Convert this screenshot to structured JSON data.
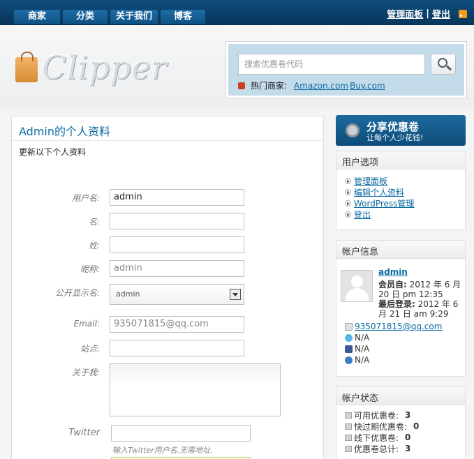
{
  "nav": {
    "tabs": [
      "商家",
      "分类",
      "关于我们",
      "博客"
    ]
  },
  "top_links": {
    "dashboard": "管理面板",
    "sep": "|",
    "logout": "登出"
  },
  "logo": {
    "text": "Clipper"
  },
  "search": {
    "placeholder": "搜索优惠卷代码",
    "hot_label": "热门商家:",
    "hot_stores": [
      "Amazon.com",
      "Buy.com"
    ]
  },
  "profile": {
    "title": "Admin的个人资料",
    "subtitle": "更新以下个人资料",
    "fields": {
      "username": {
        "label": "用户名:",
        "value": "admin"
      },
      "first_name": {
        "label": "名:",
        "value": ""
      },
      "last_name": {
        "label": "姓:",
        "value": ""
      },
      "nickname": {
        "label": "昵称:",
        "value": "admin"
      },
      "display_name": {
        "label": "公开显示名:",
        "value": "admin"
      },
      "email": {
        "label": "Email:",
        "value": "935071815@qq.com"
      },
      "website": {
        "label": "站点:",
        "value": ""
      },
      "about": {
        "label": "关于我:"
      },
      "twitter": {
        "label": "Twitter",
        "value": "",
        "hint": "输入Twitter用户名,无需地址."
      }
    }
  },
  "share": {
    "title": "分享优惠卷",
    "subtitle": "让每个人少花钱!"
  },
  "user_options": {
    "title": "用户选项",
    "items": [
      "管理面板",
      "编辑个人资料",
      "WordPress管理",
      "登出"
    ]
  },
  "account_info": {
    "title": "帐户信息",
    "name": "admin",
    "member_since_label": "会员自:",
    "member_since_value": "2012 年 6 月 20 日 pm 12:35",
    "last_login_label": "最后登录:",
    "last_login_value": "2012 年 6 月 21 日 am 9:29",
    "email": "935071815@qq.com",
    "twitter": "N/A",
    "facebook": "N/A",
    "website": "N/A"
  },
  "account_status": {
    "title": "帐户状态",
    "items": [
      {
        "label": "可用优惠卷:",
        "value": "3"
      },
      {
        "label": "快过期优惠卷:",
        "value": "0"
      },
      {
        "label": "线下优惠卷:",
        "value": "0"
      },
      {
        "label": "优惠卷总计:",
        "value": "3"
      }
    ]
  }
}
